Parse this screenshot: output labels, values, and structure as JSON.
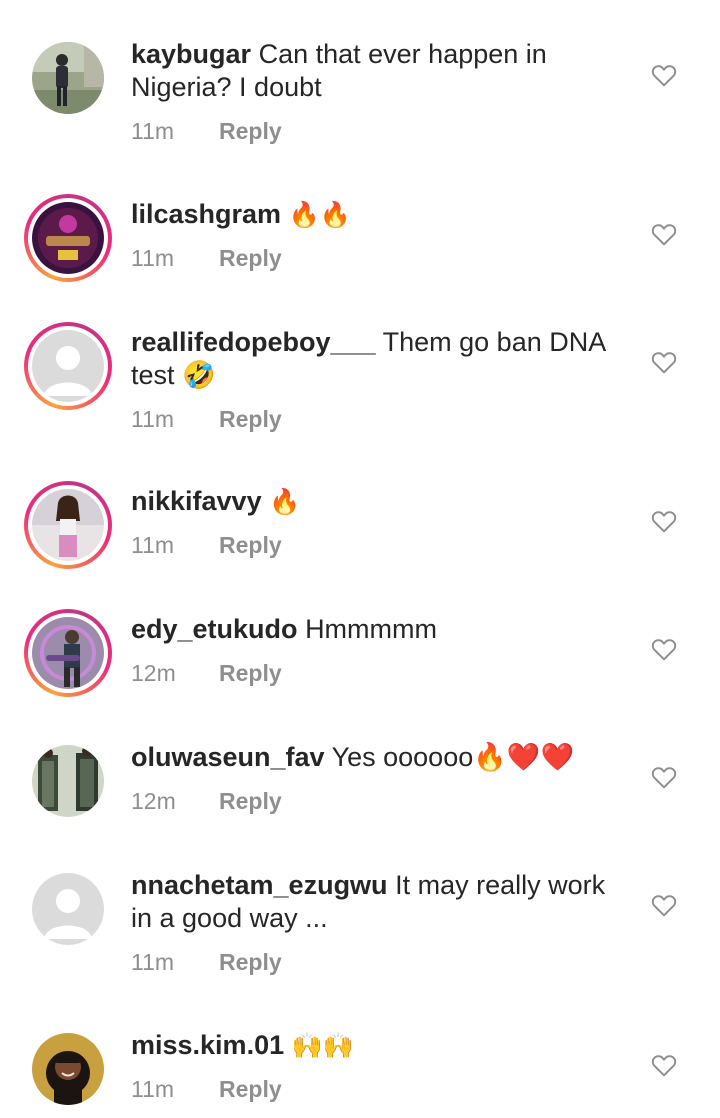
{
  "comments": [
    {
      "username": "kaybugar",
      "text": "Can that ever happen in Nigeria? I doubt",
      "time": "11m",
      "reply": "Reply",
      "avatar": "photo-person-outdoor",
      "story_ring": false
    },
    {
      "username": "lilcashgram",
      "text": "🔥🔥",
      "time": "11m",
      "reply": "Reply",
      "avatar": "standard-logo",
      "story_ring": true
    },
    {
      "username": "reallifedopeboy___",
      "text": "Them go ban DNA test 🤣",
      "time": "11m",
      "reply": "Reply",
      "avatar": "default-avatar",
      "story_ring": true
    },
    {
      "username": "nikkifavvy",
      "text": "🔥",
      "time": "11m",
      "reply": "Reply",
      "avatar": "photo-woman",
      "story_ring": true
    },
    {
      "username": "edy_etukudo",
      "text": "Hmmmmm",
      "time": "12m",
      "reply": "Reply",
      "avatar": "photo-guitarist",
      "story_ring": true
    },
    {
      "username": "oluwaseun_fav",
      "text": "Yes oooooo🔥❤️❤️",
      "time": "12m",
      "reply": "Reply",
      "avatar": "photo-fabric",
      "story_ring": false
    },
    {
      "username": "nnachetam_ezugwu",
      "text": "It may really work in a good way ...",
      "time": "11m",
      "reply": "Reply",
      "avatar": "default-avatar",
      "story_ring": false
    },
    {
      "username": "miss.kim.01",
      "text": "🙌🙌",
      "time": "11m",
      "reply": "Reply",
      "avatar": "photo-woman-portrait",
      "story_ring": false
    }
  ],
  "colors": {
    "text": "#262626",
    "meta": "#8e8e8e",
    "heart_stroke": "#8e8e8e"
  }
}
